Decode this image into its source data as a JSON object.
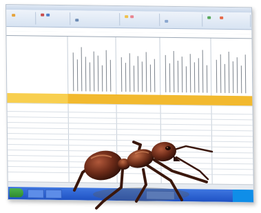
{
  "image": {
    "subject": "ant-over-spreadsheet",
    "colors": {
      "ribbon": "#d7e3f2",
      "highlight_row": "#f2b92e",
      "taskbar": "#1f52c4",
      "ant_body": "#4a1f12",
      "ant_highlight": "#9b4a2c"
    }
  }
}
